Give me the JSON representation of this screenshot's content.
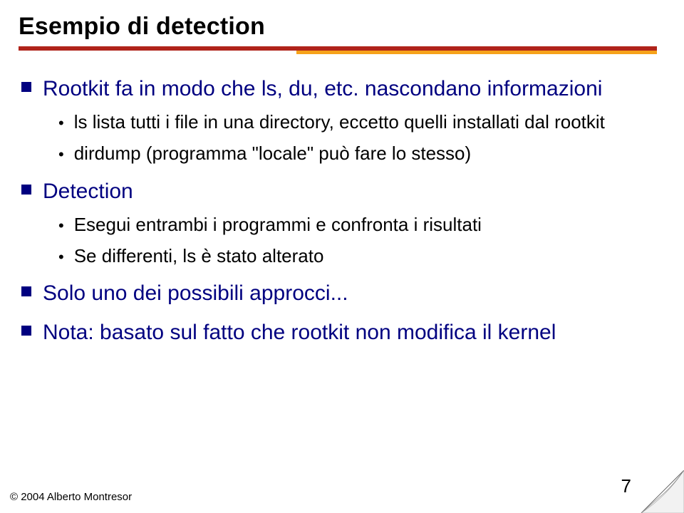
{
  "title": "Esempio di detection",
  "sections": [
    {
      "heading": "Rootkit fa in modo che ls, du, etc. nascondano informazioni",
      "items": [
        "ls lista tutti i file in una directory, eccetto quelli installati dal rootkit",
        "dirdump (programma \"locale\" può fare lo stesso)"
      ]
    },
    {
      "heading": "Detection",
      "items": [
        "Esegui entrambi i programmi e confronta i risultati",
        "Se differenti, ls è stato alterato"
      ]
    },
    {
      "heading": "Solo uno dei possibili approcci...",
      "items": []
    },
    {
      "heading": "Nota: basato sul fatto che rootkit non modifica il kernel",
      "items": []
    }
  ],
  "footer": "© 2004 Alberto Montresor",
  "page": "7"
}
